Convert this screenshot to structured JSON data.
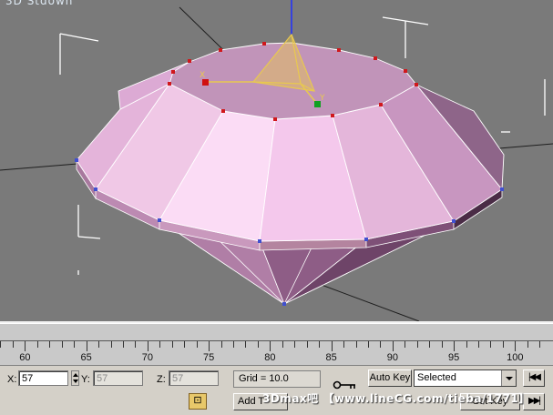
{
  "viewport": {
    "brand_text": "3D Stdown",
    "gizmo_axis_x": "X",
    "gizmo_axis_y": "Y",
    "colors": {
      "background": "#7a7a7a",
      "object_fill": "#e8b6e0",
      "selection_brackets": "#ffffff",
      "gizmo": "#e8c850"
    }
  },
  "timeline": {
    "ruler_labels": [
      "60",
      "65",
      "70",
      "75",
      "80",
      "85",
      "90",
      "95",
      "100"
    ]
  },
  "statusbar": {
    "x_label": "X:",
    "x_value": "57",
    "y_label": "Y:",
    "y_value": "57",
    "z_label": "Z:",
    "z_value": "57",
    "grid_text": "Grid = 10.0",
    "auto_key_label": "Auto Key",
    "selection_set_value": "Selected",
    "add_time_tag_label": "Add T",
    "set_key_label": "Set Key",
    "watermark_text": "3Dmax吧 【www.lineCG.com/tieba/1771】",
    "goto_start_icon": "goto-start-icon",
    "goto_end_icon": "goto-end-icon",
    "key_icon": "key-icon",
    "lock_icon": "selection-lock-icon"
  }
}
